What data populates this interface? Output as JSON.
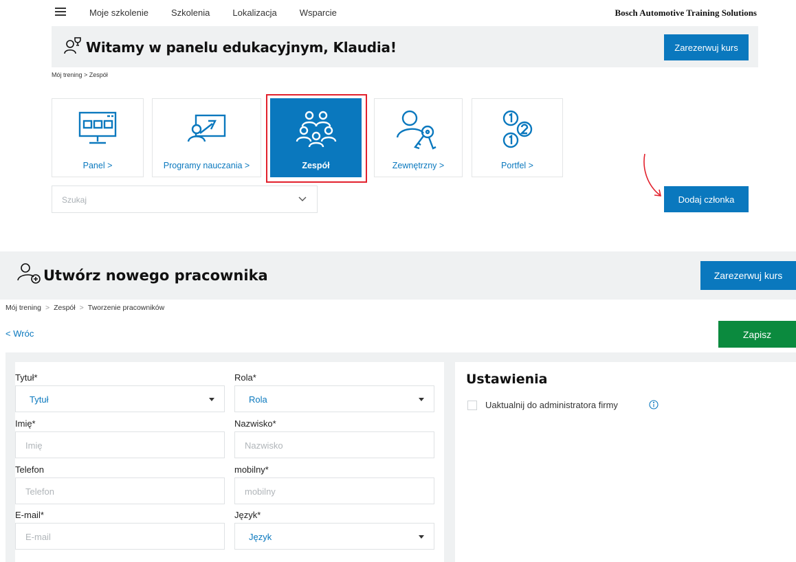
{
  "nav": {
    "links": [
      "Moje szkolenie",
      "Szkolenia",
      "Lokalizacja",
      "Wsparcie"
    ],
    "brand": "Bosch Automotive Training Solutions"
  },
  "welcome": {
    "title": "Witamy w panelu edukacyjnym, Klaudia!",
    "book_button": "Zarezerwuj kurs"
  },
  "breadcrumb_top": "Mój trening  >  Zespół",
  "tiles": [
    {
      "label": "Panel >",
      "icon": "dashboard-monitor-icon"
    },
    {
      "label": "Programy nauczania >",
      "icon": "curriculum-board-icon"
    },
    {
      "label": "Zespół",
      "icon": "team-group-icon",
      "active": true
    },
    {
      "label": "Zewnętrzny >",
      "icon": "external-user-key-icon"
    },
    {
      "label": "Portfel >",
      "icon": "portfolio-coins-icon"
    }
  ],
  "search": {
    "placeholder": "Szukaj"
  },
  "add_member_button": "Dodaj członka",
  "create": {
    "title": "Utwórz nowego pracownika",
    "book_button": "Zarezerwuj kurs",
    "breadcrumb": [
      "Mój trening",
      "Zespół",
      "Tworzenie pracowników"
    ],
    "back": "Wróc",
    "save": "Zapisz"
  },
  "form": {
    "title_label": "Tytuł*",
    "title_value": "Tytuł",
    "role_label": "Rola*",
    "role_value": "Rola",
    "first_name_label": "Imię*",
    "first_name_placeholder": "Imię",
    "last_name_label": "Nazwisko*",
    "last_name_placeholder": "Nazwisko",
    "phone_label": "Telefon",
    "phone_placeholder": "Telefon",
    "mobile_label": "mobilny*",
    "mobile_placeholder": "mobilny",
    "email_label": "E-mail*",
    "email_placeholder": "E-mail",
    "language_label": "Język*",
    "language_value": "Język"
  },
  "settings": {
    "title": "Ustawienia",
    "upgrade_label": "Uaktualnij do administratora firmy"
  },
  "colors": {
    "accent": "#0a78be",
    "save": "#0b8a3e",
    "highlight": "#e2202c",
    "panel_bg": "#eff1f2"
  }
}
